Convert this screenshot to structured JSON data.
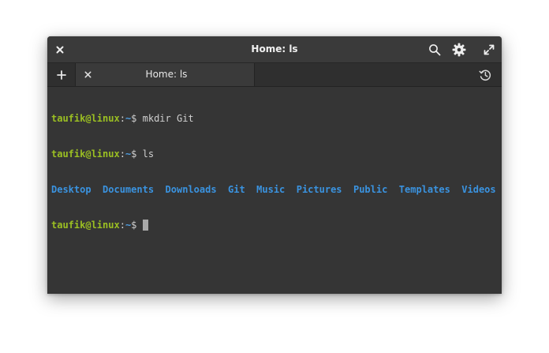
{
  "window": {
    "title": "Home: ls"
  },
  "tabs": [
    {
      "label": "Home: ls",
      "active": true
    }
  ],
  "icons": {
    "close": "close-icon",
    "search": "search-icon",
    "settings": "gear-icon",
    "maximize": "maximize-icon",
    "new_tab": "plus-icon",
    "tab_close": "close-icon",
    "history": "history-icon"
  },
  "colors": {
    "prompt_user": "#9bbf22",
    "prompt_path": "#4e9de0",
    "directory": "#3a93e0",
    "background": "#353535",
    "text": "#d0d0d0"
  },
  "terminal": {
    "lines": [
      {
        "user": "taufik@linux",
        "sep": ":",
        "path": "~",
        "symbol": "$ ",
        "command": "mkdir Git"
      },
      {
        "user": "taufik@linux",
        "sep": ":",
        "path": "~",
        "symbol": "$ ",
        "command": "ls"
      }
    ],
    "ls_output": [
      "Desktop",
      "Documents",
      "Downloads",
      "Git",
      "Music",
      "Pictures",
      "Public",
      "Templates",
      "Videos"
    ],
    "current_prompt": {
      "user": "taufik@linux",
      "sep": ":",
      "path": "~",
      "symbol": "$ "
    }
  }
}
